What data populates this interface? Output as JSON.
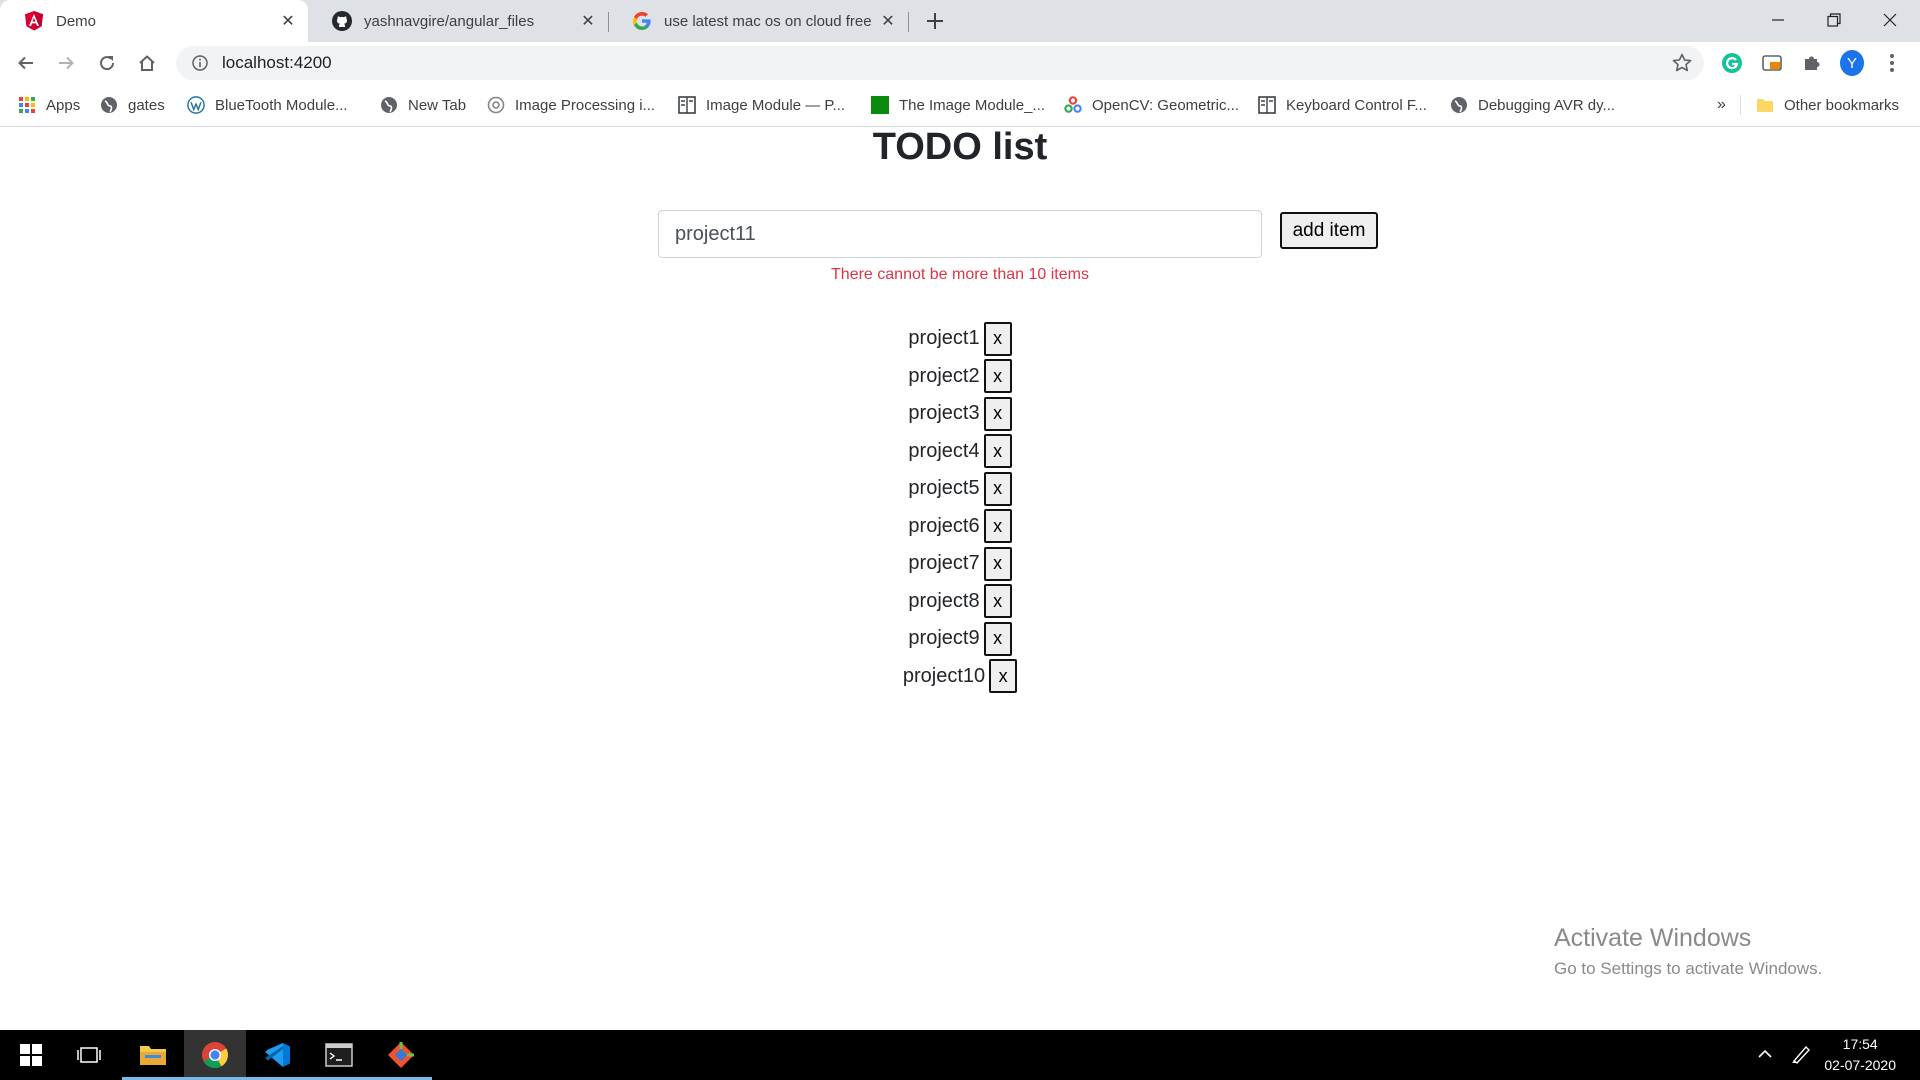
{
  "browser": {
    "tabs": [
      {
        "title": "Demo",
        "favicon": "angular-icon",
        "active": true
      },
      {
        "title": "yashnavgire/angular_files",
        "favicon": "github-icon",
        "active": false
      },
      {
        "title": "use latest mac os on cloud free",
        "favicon": "google-icon",
        "active": false
      }
    ],
    "url": "localhost:4200",
    "profile_initial": "Y",
    "bookmarks": [
      {
        "label": "Apps",
        "icon": "apps-grid-icon"
      },
      {
        "label": "gates",
        "icon": "globe-icon"
      },
      {
        "label": "BlueTooth Module...",
        "icon": "wordpress-icon"
      },
      {
        "label": "New Tab",
        "icon": "globe-icon"
      },
      {
        "label": "Image Processing i...",
        "icon": "settings-globe-icon"
      },
      {
        "label": "Image Module — P...",
        "icon": "book-icon"
      },
      {
        "label": "The Image Module_...",
        "icon": "green-square-icon"
      },
      {
        "label": "OpenCV: Geometric...",
        "icon": "opencv-icon"
      },
      {
        "label": "Keyboard Control F...",
        "icon": "book-icon"
      },
      {
        "label": "Debugging AVR dy...",
        "icon": "globe-icon"
      }
    ],
    "overflow_label": "»",
    "other_bookmarks": "Other bookmarks"
  },
  "page": {
    "title": "TODO list",
    "input_value": "project11",
    "add_button": "add item",
    "error": "There cannot be more than 10 items",
    "delete_label": "x",
    "items": [
      "project1",
      "project2",
      "project3",
      "project4",
      "project5",
      "project6",
      "project7",
      "project8",
      "project9",
      "project10"
    ]
  },
  "watermark": {
    "line1": "Activate Windows",
    "line2": "Go to Settings to activate Windows."
  },
  "taskbar": {
    "time": "17:54",
    "date": "02-07-2020"
  },
  "colors": {
    "error": "#dc3545",
    "tabstrip": "#dee1e6",
    "profile": "#1a73e8"
  }
}
